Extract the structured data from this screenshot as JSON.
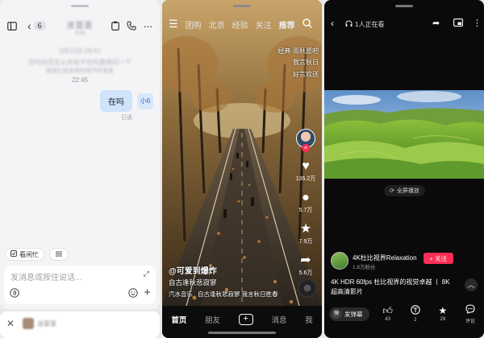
{
  "chat": {
    "header": {
      "back_count": "6",
      "title": "淑蕾蕾",
      "subtitle": "在线"
    },
    "blurred_lines": [
      "3月15日 09:41",
      "在吗你还在么你在不在吗我想问一下",
      "那我们周末再约吧不好意思"
    ],
    "time_label": "22:45",
    "message": {
      "text": "在吗",
      "avatar": "小6"
    },
    "read_label": "已读",
    "chips": [
      {
        "label": "看闲忙",
        "icon": "check-icon"
      },
      {
        "label": "",
        "icon": "menu-icon"
      }
    ],
    "input": {
      "placeholder": "发消息或按住说话..."
    },
    "mini_bar": {
      "name": "淑蕾蕾"
    }
  },
  "video": {
    "top_tabs": [
      "团购",
      "北京",
      "经验",
      "关注",
      "推荐"
    ],
    "active_tab": "推荐",
    "overlay_lines": [
      "经典·雨秋愿吧",
      "我言秋日",
      "我言秋日",
      "好言欢送"
    ],
    "side": {
      "likes": "135.2万",
      "comments": "5.7万",
      "favorites": "7.9万",
      "shares": "5.6万"
    },
    "author": "@可爱到爆炸",
    "description": "自古逢秋悲寂寥",
    "music": [
      "汽水音乐",
      "自古逢秋悲寂寥 我言秋日胜春"
    ],
    "bottom_nav": [
      "首页",
      "朋友",
      "+",
      "消息",
      "我"
    ],
    "active_nav": "首页"
  },
  "player": {
    "viewers": "1人正在看",
    "fullscreen_label": "全屏播放",
    "channel": {
      "name": "4K杜比视界Relaxation",
      "fans": "1.8万粉丝",
      "follow_label": "+ 关注"
    },
    "title": "4K HDR 60fps 杜比视界的视觉卓越 丨 8K超高清影片",
    "danmu_label": "发弹幕",
    "actions": [
      {
        "icon": "thumb-up-icon",
        "label": "43"
      },
      {
        "icon": "coin-icon",
        "label": "2"
      },
      {
        "icon": "star-icon",
        "label": "29"
      },
      {
        "icon": "comment-icon",
        "label": "评论"
      }
    ]
  },
  "colors": {
    "chat_bubble": "#cfe3fb",
    "accent_red": "#fe2c55",
    "dark_bg": "#0a0a0a"
  }
}
